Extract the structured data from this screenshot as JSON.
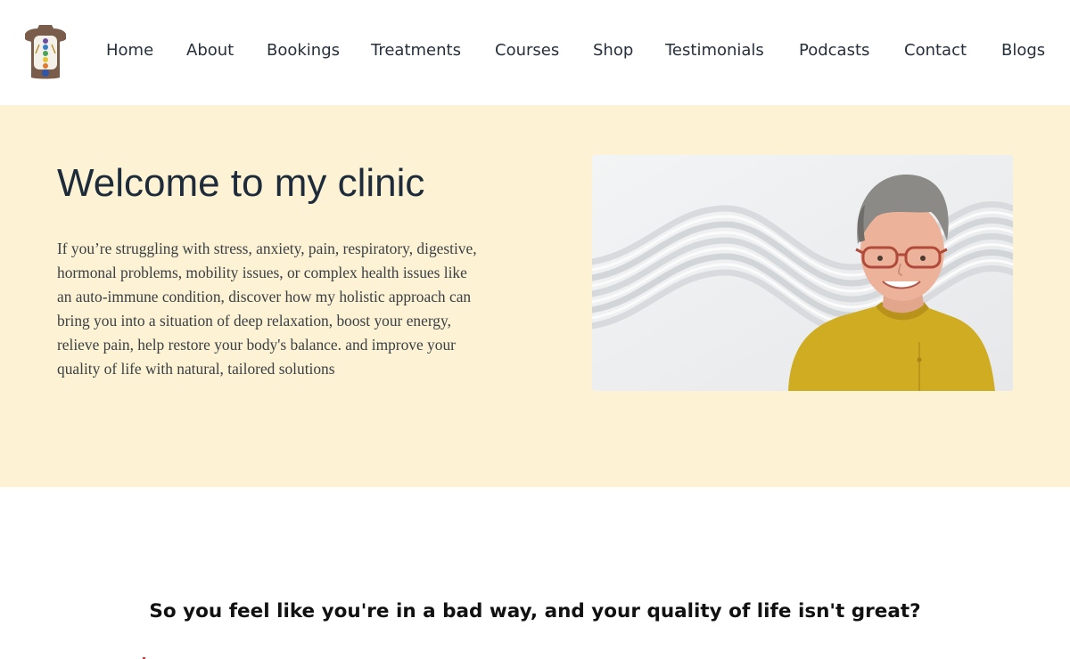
{
  "header": {
    "logo_icon": "body-chakra-logo-icon",
    "nav": [
      {
        "label": "Home"
      },
      {
        "label": "About"
      },
      {
        "label": "Bookings"
      },
      {
        "label": "Treatments"
      },
      {
        "label": "Courses"
      },
      {
        "label": "Shop"
      },
      {
        "label": "Testimonials"
      },
      {
        "label": "Podcasts"
      },
      {
        "label": "Contact"
      },
      {
        "label": "Blogs"
      }
    ]
  },
  "hero": {
    "title": "Welcome to my clinic",
    "text": "If you’re struggling with stress, anxiety, pain, respiratory, digestive, hormonal problems, mobility issues, or complex health issues like an auto-immune condition, discover how my holistic approach can bring you into a situation of deep relaxation, boost your energy, relieve pain, help restore your body's balance. and improve your quality of life with natural, tailored solutions",
    "photo": "practitioner-portrait-on-zen-sand-image",
    "background_color": "#fdf2d3"
  },
  "section": {
    "subheading": "So you feel like you're in a bad way, and your quality of life isn't great?"
  },
  "colors": {
    "hero_bg": "#fdf2d3",
    "heading": "#1d2b3a",
    "nav_text": "#26303a"
  }
}
